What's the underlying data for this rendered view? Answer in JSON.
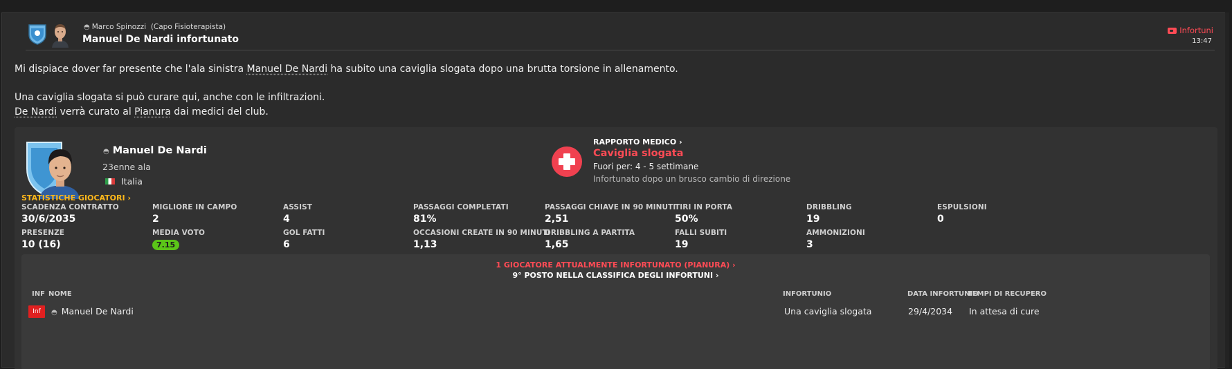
{
  "message": {
    "sender_name": "Marco Spinozzi",
    "sender_role": "(Capo Fisioterapista)",
    "subject": "Manuel De Nardi infortunato",
    "tag": "Infortuni",
    "time": "13:47",
    "para1_a": "Mi dispiace dover far presente che l'ala sinistra ",
    "para1_link": "Manuel De Nardi",
    "para1_b": " ha subito una caviglia slogata dopo una brutta torsione in allenamento.",
    "para2": "Una caviglia slogata si può curare qui, anche con le infiltrazioni.",
    "para3_link1": "De Nardi",
    "para3_a": " verrà curato al ",
    "para3_link2": "Pianura",
    "para3_b": " dai medici del club."
  },
  "player": {
    "name": "Manuel De Nardi",
    "age_role": "23enne ala",
    "nationality": "Italia"
  },
  "medical": {
    "title": "RAPPORTO MEDICO",
    "injury": "Caviglia slogata",
    "out_for": "Fuori per: 4 - 5 settimane",
    "description": "Infortunato dopo un brusco cambio di direzione"
  },
  "stats": {
    "header": "STATISTICHE GIOCATORI",
    "items": [
      {
        "label": "SCADENZA CONTRATTO",
        "value": "30/6/2035"
      },
      {
        "label": "MIGLIORE IN CAMPO",
        "value": "2"
      },
      {
        "label": "ASSIST",
        "value": "4"
      },
      {
        "label": "PASSAGGI COMPLETATI",
        "value": "81%"
      },
      {
        "label": "PASSAGGI CHIAVE IN 90 MINUTI",
        "value": "2,51"
      },
      {
        "label": "TIRI IN PORTA",
        "value": "50%"
      },
      {
        "label": "DRIBBLING",
        "value": "19"
      },
      {
        "label": "ESPULSIONI",
        "value": "0"
      },
      {
        "label": "PRESENZE",
        "value": "10 (16)"
      },
      {
        "label": "MEDIA VOTO",
        "value": "7.15"
      },
      {
        "label": "GOL FATTI",
        "value": "6"
      },
      {
        "label": "OCCASIONI CREATE IN 90 MINUTI",
        "value": "1,13"
      },
      {
        "label": "DRIBBLING A PARTITA",
        "value": "1,65"
      },
      {
        "label": "FALLI SUBITI",
        "value": "19"
      },
      {
        "label": "AMMONIZIONI",
        "value": "3"
      }
    ]
  },
  "injury_table": {
    "count_text": "1 GIOCATORE ATTUALMENTE INFORTUNATO (PIANURA)",
    "rank_text": "9° POSTO NELLA CLASSIFICA DEGLI INFORTUNI",
    "columns": {
      "inf": "INF",
      "name": "NOME",
      "injury": "INFORTUNIO",
      "date": "DATA INFORTUNIO",
      "recovery": "TEMPI DI RECUPERO"
    },
    "rows": [
      {
        "badge": "Inf",
        "name": "Manuel De Nardi",
        "injury": "Una caviglia slogata",
        "date": "29/4/2034",
        "recovery": "In attesa di cure"
      }
    ]
  },
  "colors": {
    "accent_red": "#ff4b55",
    "stats_header": "#ffb81a",
    "rating_green": "#5bc518",
    "badge_red": "#e02020"
  },
  "chevron": "›"
}
